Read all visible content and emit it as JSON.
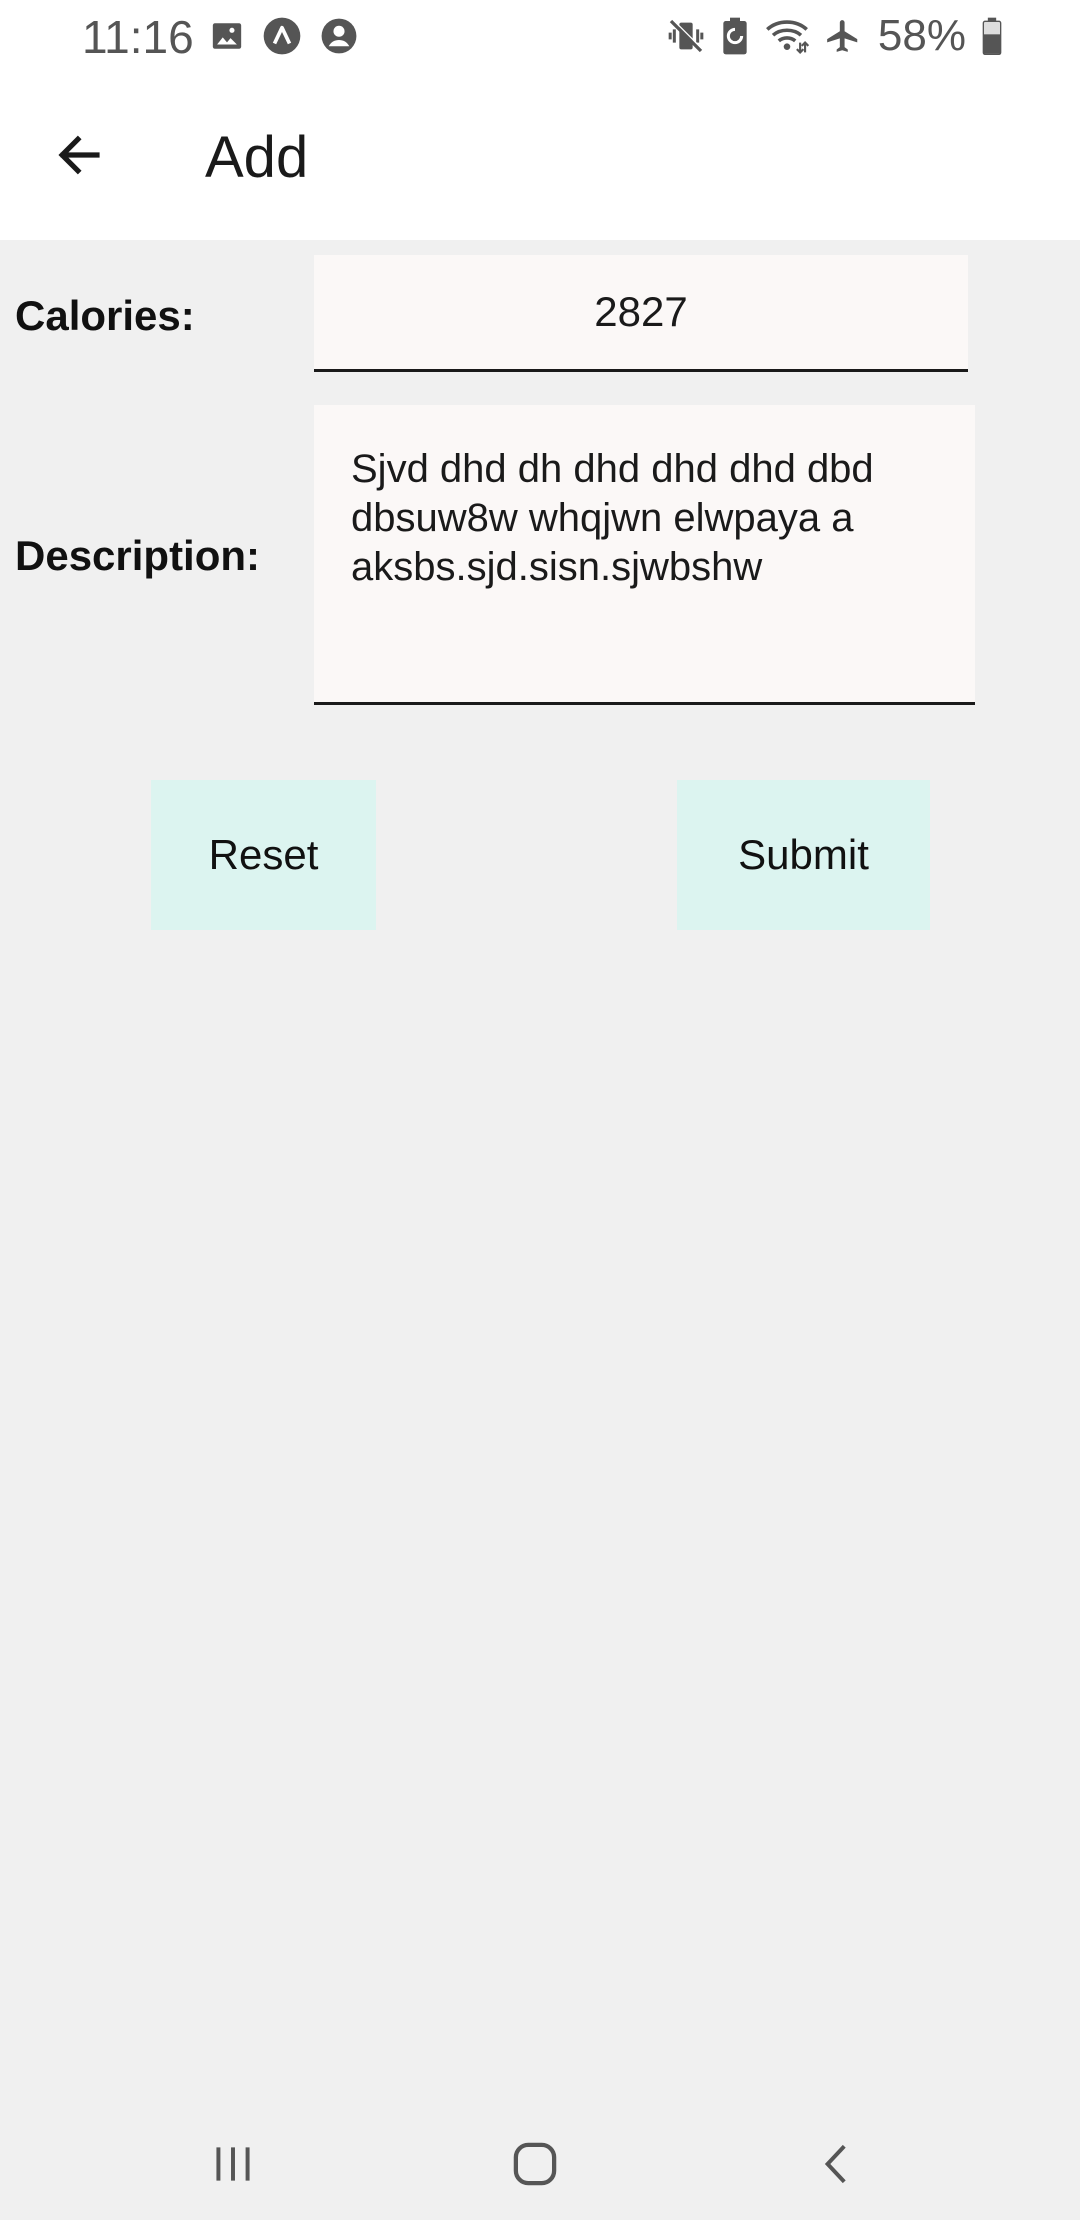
{
  "status_bar": {
    "time": "11:16",
    "battery_percent": "58%",
    "left_icons": [
      "gallery-icon",
      "app-notification-icon",
      "account-icon"
    ],
    "right_icons": [
      "vibrate-mute-icon",
      "battery-saver-icon",
      "wifi-icon",
      "airplane-mode-icon",
      "battery-icon"
    ]
  },
  "app_bar": {
    "title": "Add",
    "back_icon": "arrow-left-icon"
  },
  "form": {
    "calories_label": "Calories:",
    "calories_value": "2827",
    "description_label": "Description:",
    "description_value": "Sjvd dhd dh dhd dhd dhd dbd dbsuw8w whqjwn elwpaya a aksbs.sjd.sisn.sjwbshw"
  },
  "buttons": {
    "reset_label": "Reset",
    "submit_label": "Submit"
  },
  "nav_bar": {
    "icons": [
      "recents-icon",
      "home-icon",
      "back-icon"
    ]
  },
  "colors": {
    "background": "#f0f0f0",
    "app_bar": "#ffffff",
    "input_background": "#fbf8f7",
    "button_background": "#dcf4f0",
    "text": "#1a1a1a"
  }
}
